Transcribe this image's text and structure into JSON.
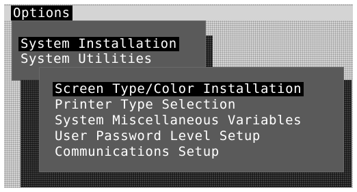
{
  "menubar": {
    "title": "Options"
  },
  "menu1": {
    "items": [
      {
        "label": "System Installation",
        "selected": true
      },
      {
        "label": "System Utilities",
        "selected": false
      }
    ]
  },
  "menu2": {
    "items": [
      {
        "label": "Screen Type/Color Installation",
        "selected": true
      },
      {
        "label": "Printer Type Selection",
        "selected": false
      },
      {
        "label": "System Miscellaneous Variables",
        "selected": false
      },
      {
        "label": "User Password Level Setup",
        "selected": false
      },
      {
        "label": "Communications Setup",
        "selected": false
      }
    ]
  },
  "colors": {
    "panel": "#5a5a5a",
    "highlight": "#000000",
    "text": "#ffffff",
    "desktop": "#d4d4d4"
  }
}
